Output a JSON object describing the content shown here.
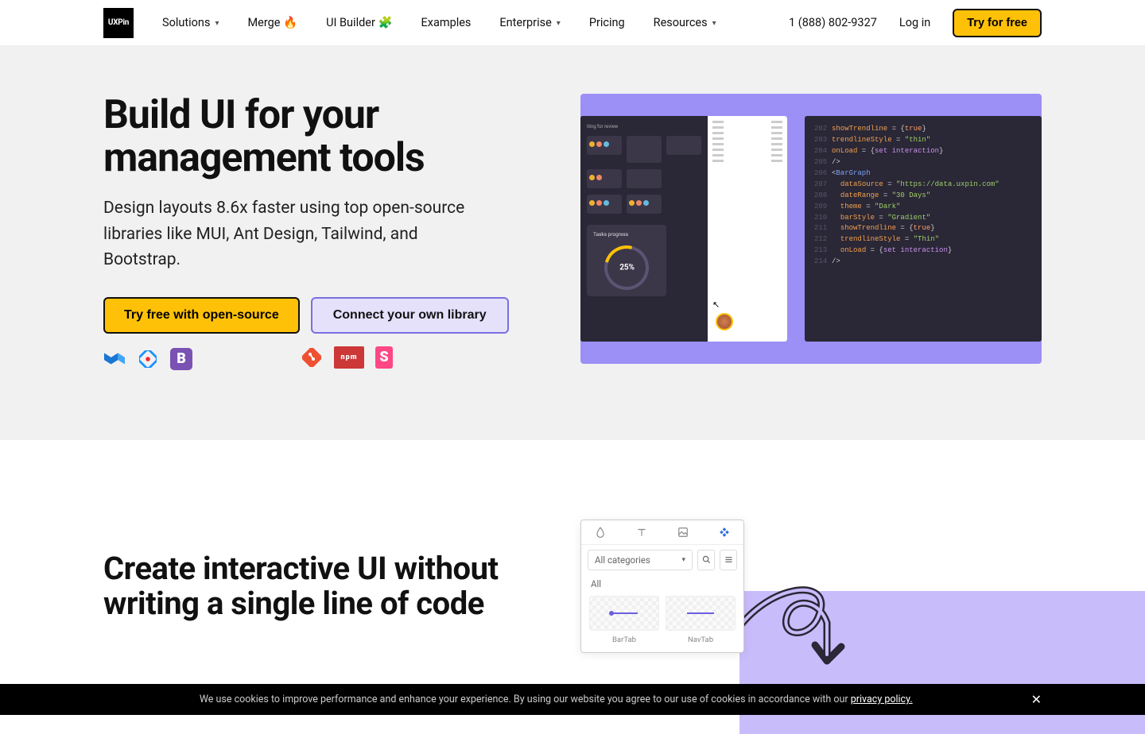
{
  "nav": {
    "logo_text": "UXPin",
    "items": [
      {
        "label": "Solutions",
        "has_dropdown": true
      },
      {
        "label": "Merge 🔥",
        "has_dropdown": false
      },
      {
        "label": "UI Builder 🧩",
        "has_dropdown": false
      },
      {
        "label": "Examples",
        "has_dropdown": false
      },
      {
        "label": "Enterprise",
        "has_dropdown": true
      },
      {
        "label": "Pricing",
        "has_dropdown": false
      },
      {
        "label": "Resources",
        "has_dropdown": true
      }
    ],
    "phone": "1 (888) 802-9327",
    "login": "Log in",
    "cta": "Try for free"
  },
  "hero": {
    "title_line1": "Build UI for your",
    "title_line2": "management tools",
    "subtitle": "Design layouts 8.6x faster using top open-source libraries like MUI, Ant Design, Tailwind, and Bootstrap.",
    "cta_primary": "Try free with open-source",
    "cta_secondary": "Connect your own library",
    "lib_icons_group1": [
      "mui",
      "antd",
      "bootstrap"
    ],
    "lib_icons_group2": [
      "git",
      "npm",
      "storybook"
    ]
  },
  "hero_illustration": {
    "dark_panel": {
      "col_header": "iting for review",
      "progress_card_title": "Tasks progress",
      "progress_pct": "25%"
    },
    "code": {
      "lines": [
        {
          "n": "202",
          "t": "  showTrendline = {true}"
        },
        {
          "n": "203",
          "t": "  trendlineStyle = \"thin\""
        },
        {
          "n": "204",
          "t": "  onLoad = {set interaction}"
        },
        {
          "n": "205",
          "t": "/>"
        },
        {
          "n": "206",
          "t": "<BarGraph"
        },
        {
          "n": "207",
          "t": "  dataSource = \"https://data.uxpin.com\""
        },
        {
          "n": "208",
          "t": "  dateRange = \"30 Days\""
        },
        {
          "n": "209",
          "t": "  theme = \"Dark\""
        },
        {
          "n": "210",
          "t": "  barStyle = \"Gradient\""
        },
        {
          "n": "211",
          "t": "  showTrendline = {true}"
        },
        {
          "n": "212",
          "t": "  trendlineStyle = \"Thin\""
        },
        {
          "n": "213",
          "t": "  onLoad = {set interaction}"
        },
        {
          "n": "214",
          "t": "/>"
        }
      ]
    }
  },
  "section2": {
    "title": "Create interactive UI without writing a single line of code",
    "panel": {
      "select_label": "All categories",
      "all_label": "All",
      "components": [
        {
          "label": "BarTab"
        },
        {
          "label": "NavTab"
        }
      ]
    }
  },
  "cookie": {
    "message": "We use cookies to improve performance and enhance your experience. By using our website you agree to our use of cookies in accordance with our ",
    "link": "privacy policy."
  },
  "colors": {
    "accent_yellow": "#ffc107",
    "accent_purple": "#9c8ff5",
    "accent_purple_light": "#c9bcfb",
    "dark_bg": "#2a2736"
  }
}
